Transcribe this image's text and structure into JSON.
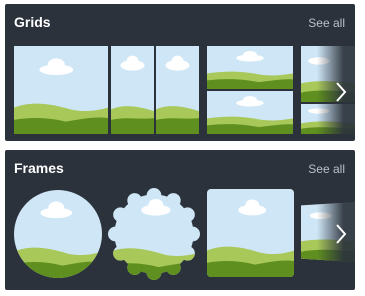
{
  "sections": {
    "grids": {
      "title": "Grids",
      "see_all": "See all"
    },
    "frames": {
      "title": "Frames",
      "see_all": "See all"
    }
  },
  "icons": {
    "next": "chevron-right-icon"
  },
  "colors": {
    "panel_bg": "#2b323b",
    "sky": "#cfe6f7",
    "cloud": "#ffffff",
    "hill_light": "#a8c85a",
    "hill_dark": "#5e8f1f",
    "see_all_text": "#b9c0c8"
  }
}
